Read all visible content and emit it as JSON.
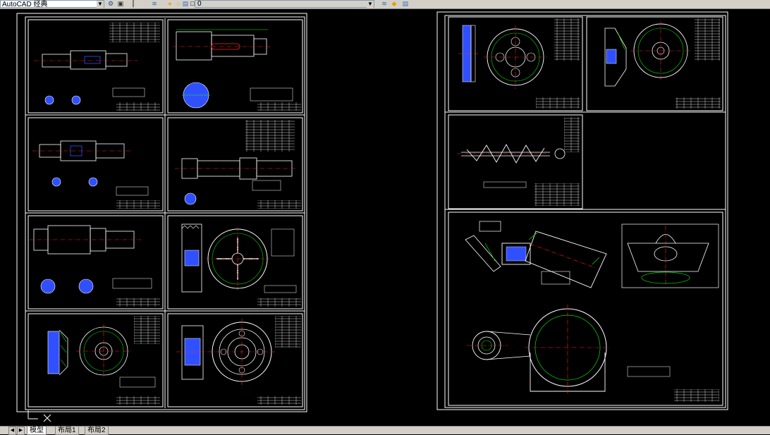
{
  "toolbar": {
    "workspace_value": "AutoCAD 经典",
    "layer_value": "0",
    "icons": [
      "workspace-settings-icon",
      "toolbar-lock-icon",
      "layer-properties-icon",
      "layer-state-icon",
      "layer-previous-icon"
    ]
  },
  "tabs": {
    "items": [
      {
        "label": "模型",
        "active": true
      },
      {
        "label": "布局1",
        "active": false
      },
      {
        "label": "布局2",
        "active": false
      }
    ]
  },
  "colors": {
    "background": "#000000",
    "frame": "#ffffff",
    "center_line": "#ff2020",
    "dimension": "#00ff00",
    "hatch": "#3050ff",
    "pitch": "#00e000"
  }
}
